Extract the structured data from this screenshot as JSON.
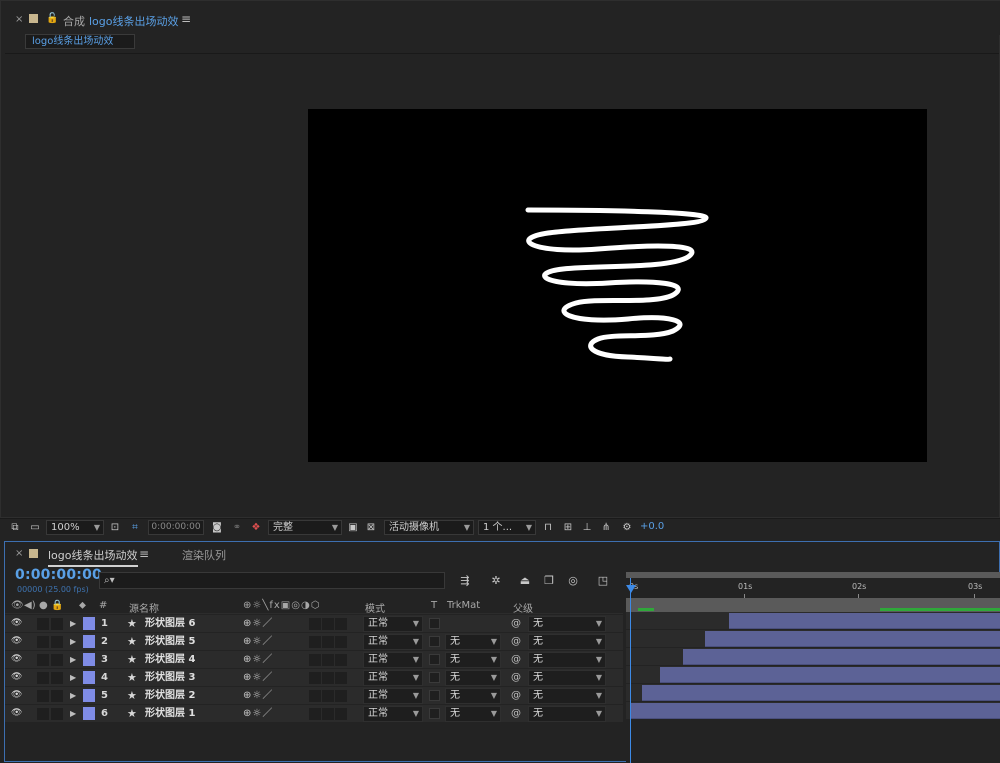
{
  "comp_panel": {
    "close": "×",
    "lock": "🔓",
    "label": "合成",
    "comp_name": "logo线条出场动效",
    "menu": "≡",
    "subtab": "logo线条出场动效"
  },
  "viewer_toolbar": {
    "zoom": "100%",
    "timecode": "0:00:00:00",
    "resolution": "完整",
    "camera": "活动摄像机",
    "views": "1 个...",
    "exposure": "+0.0"
  },
  "timeline": {
    "close": "×",
    "comp_name": "logo线条出场动效",
    "menu": "≡",
    "render_queue": "渲染队列",
    "timecode": "0:00:00:00",
    "fps": "00000 (25.00 fps)",
    "search_icon": "⌕▾",
    "columns": {
      "hash": "#",
      "source_name": "源名称",
      "mode": "模式",
      "t": "T",
      "trkmat": "TrkMat",
      "parent": "父级"
    },
    "ruler": [
      "0s",
      "01s",
      "02s",
      "03s"
    ],
    "layers": [
      {
        "num": "1",
        "name": "形状图层 6",
        "mode": "正常",
        "trkmat": "",
        "parent": "无",
        "start": 0.85
      },
      {
        "num": "2",
        "name": "形状图层 5",
        "mode": "正常",
        "trkmat": "无",
        "parent": "无",
        "start": 0.65
      },
      {
        "num": "3",
        "name": "形状图层 4",
        "mode": "正常",
        "trkmat": "无",
        "parent": "无",
        "start": 0.46
      },
      {
        "num": "4",
        "name": "形状图层 3",
        "mode": "正常",
        "trkmat": "无",
        "parent": "无",
        "start": 0.26
      },
      {
        "num": "5",
        "name": "形状图层 2",
        "mode": "正常",
        "trkmat": "无",
        "parent": "无",
        "start": 0.1
      },
      {
        "num": "6",
        "name": "形状图层 1",
        "mode": "正常",
        "trkmat": "无",
        "parent": "无",
        "start": 0.0
      }
    ]
  },
  "colors": {
    "accent": "#5aa0e6",
    "label_color": "#7f8ce6",
    "bar": "#5c6296",
    "canvas": "#000000"
  }
}
